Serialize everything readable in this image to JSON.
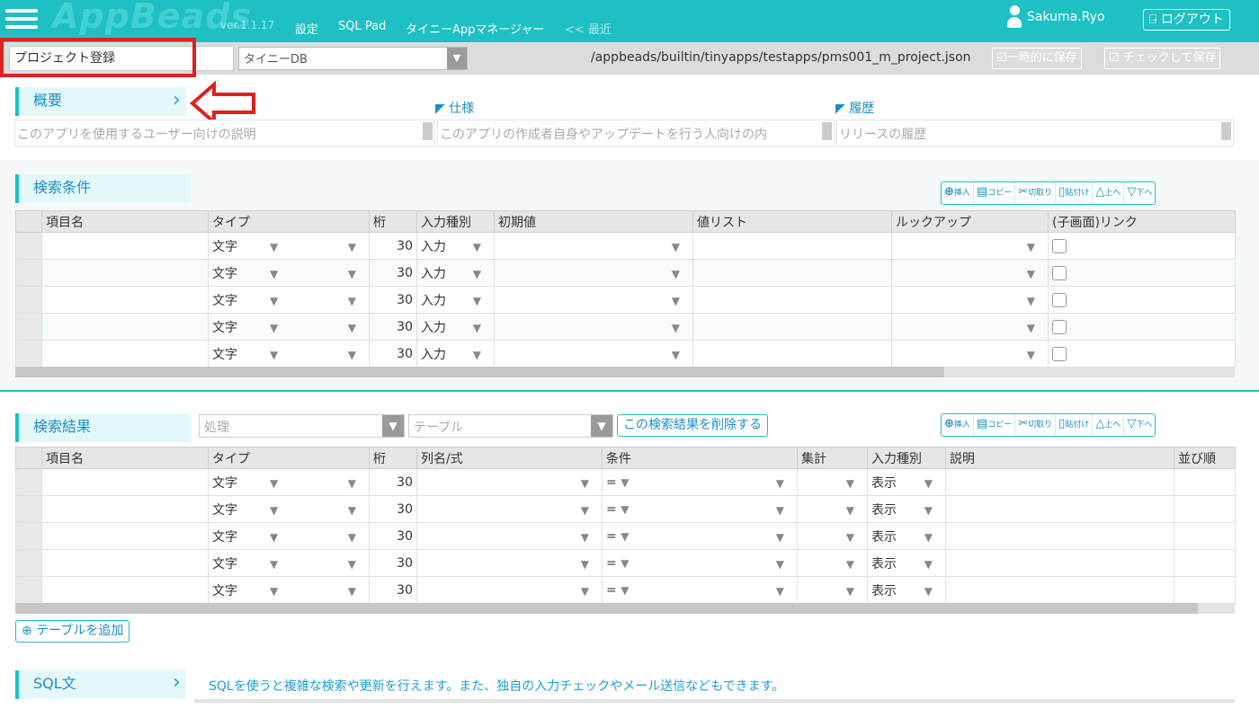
{
  "header": {
    "logo": "AppBeads",
    "version": "ver.1.1.17",
    "nav": [
      "設定",
      "SQL Pad",
      "タイニーAppマネージャー"
    ],
    "recent": "<< 最近",
    "user_name": "Sakuma.Ryo",
    "logout": "ログアウト"
  },
  "toolbar": {
    "app_name": "プロジェクト登録",
    "db_select": "タイニーDB",
    "file_path": "/appbeads/builtin/tinyapps/testapps/pms001_m_project.json",
    "save_temp": "一時的に保存",
    "save_check": "チェックして保存"
  },
  "overview": {
    "title": "概要",
    "spec_label": "仕様",
    "history_label": "履歴",
    "desc_placeholder": "このアプリを使用するユーザー向けの説明",
    "spec_placeholder": "このアプリの作成者自身やアップデートを行う人向けの内",
    "history_placeholder": "リリースの履歴"
  },
  "row_tools": {
    "insert": "挿入",
    "copy": "コピー",
    "cut": "切取り",
    "paste": "貼付け",
    "up": "上へ",
    "down": "下へ"
  },
  "search_conditions": {
    "title": "検索条件",
    "columns": [
      "項目名",
      "タイプ",
      "桁",
      "入力種別",
      "初期値",
      "値リスト",
      "ルックアップ",
      "(子画面)リンク"
    ],
    "rows": [
      {
        "type": "文字",
        "digits": "30",
        "input": "入力"
      },
      {
        "type": "文字",
        "digits": "30",
        "input": "入力"
      },
      {
        "type": "文字",
        "digits": "30",
        "input": "入力"
      },
      {
        "type": "文字",
        "digits": "30",
        "input": "入力"
      },
      {
        "type": "文字",
        "digits": "30",
        "input": "入力"
      }
    ]
  },
  "search_results": {
    "title": "検索結果",
    "process_placeholder": "処理",
    "table_placeholder": "テーブル",
    "delete_button": "この検索結果を削除する",
    "columns": [
      "項目名",
      "タイプ",
      "桁",
      "列名/式",
      "条件",
      "集計",
      "入力種別",
      "説明",
      "並び順"
    ],
    "rows": [
      {
        "type": "文字",
        "digits": "30",
        "cond": "=",
        "input": "表示"
      },
      {
        "type": "文字",
        "digits": "30",
        "cond": "=",
        "input": "表示"
      },
      {
        "type": "文字",
        "digits": "30",
        "cond": "=",
        "input": "表示"
      },
      {
        "type": "文字",
        "digits": "30",
        "cond": "=",
        "input": "表示"
      },
      {
        "type": "文字",
        "digits": "30",
        "cond": "=",
        "input": "表示"
      }
    ],
    "add_table": "テーブルを追加"
  },
  "sql": {
    "title": "SQL文",
    "help": "SQLを使うと複雑な検索や更新を行えます。また、独自の入力チェックやメール送信などもできます。"
  }
}
